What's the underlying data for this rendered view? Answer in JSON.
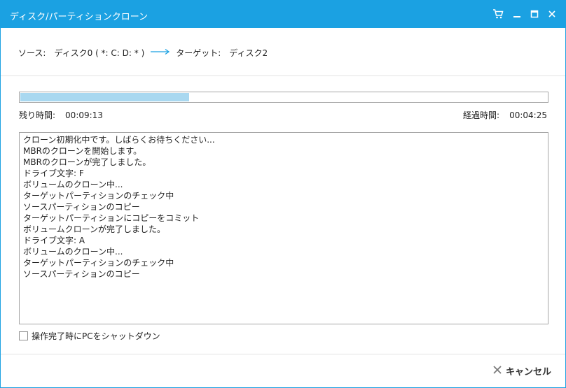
{
  "window": {
    "title": "ディスク/パーティションクローン",
    "controls": [
      "cart-icon",
      "minimize-icon",
      "maximize-icon",
      "close-icon"
    ]
  },
  "route": {
    "source_label": "ソース:",
    "source_value": "ディスク0 ( *: C: D: * )",
    "target_label": "ターゲット:",
    "target_value": "ディスク2",
    "arrow_icon": "arrow-right-icon"
  },
  "progress": {
    "percent": 32
  },
  "time": {
    "remaining_label": "残り時間:",
    "remaining_value": "00:09:13",
    "elapsed_label": "経過時間:",
    "elapsed_value": "00:04:25"
  },
  "log": {
    "lines": [
      "クローン初期化中です。しばらくお待ちください...",
      "MBRのクローンを開始します。",
      "MBRのクローンが完了しました。",
      "ドライブ文字: F",
      "ボリュームのクローン中...",
      "ターゲットパーティションのチェック中",
      "ソースパーティションのコピー",
      "ターゲットパーティションにコピーをコミット",
      "ボリュームクローンが完了しました。",
      "ドライブ文字: A",
      "ボリュームのクローン中...",
      "ターゲットパーティションのチェック中",
      "ソースパーティションのコピー"
    ]
  },
  "options": {
    "shutdown_label": "操作完了時にPCをシャットダウン",
    "shutdown_checked": false
  },
  "footer": {
    "cancel_label": "キャンセル"
  },
  "colors": {
    "titlebar": "#1ba1e2",
    "progress_fill": "#a9d8f0"
  }
}
